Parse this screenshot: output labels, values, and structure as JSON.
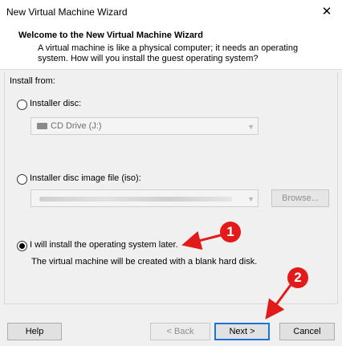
{
  "window": {
    "title": "New Virtual Machine Wizard",
    "close_glyph": "✕"
  },
  "header": {
    "title": "Welcome to the New Virtual Machine Wizard",
    "description": "A virtual machine is like a physical computer; it needs an operating system. How will you install the guest operating system?"
  },
  "install": {
    "section_label": "Install from:",
    "options": [
      {
        "label": "Installer disc:",
        "selected": false
      },
      {
        "label": "Installer disc image file (iso):",
        "selected": false
      },
      {
        "label": "I will install the operating system later.",
        "selected": true
      }
    ],
    "disc_drive": {
      "value": "CD Drive (J:)",
      "icon": "cd-drive-icon"
    },
    "browse_label": "Browse...",
    "later_note": "The virtual machine will be created with a blank hard disk."
  },
  "footer": {
    "help_label": "Help",
    "back_label": "< Back",
    "next_label": "Next >",
    "cancel_label": "Cancel"
  },
  "annotations": {
    "marker_1": "1",
    "marker_2": "2",
    "color": "#e21a1a"
  }
}
